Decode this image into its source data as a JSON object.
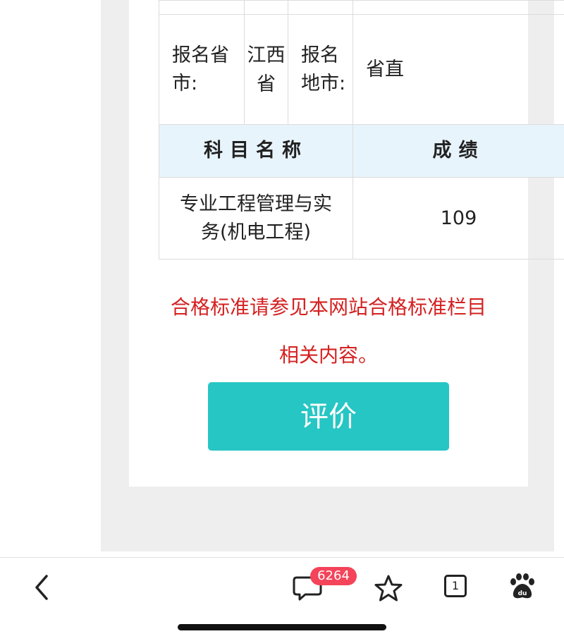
{
  "table": {
    "province_label": "报名省市:",
    "province_value": "江西省",
    "city_label": "报名地市:",
    "city_value": "省直",
    "subject_header": "科目名称",
    "score_header": "成绩",
    "subject_name": "专业工程管理与实务(机电工程)",
    "score_value": "109"
  },
  "notice": {
    "line1": "合格标准请参见本网站合格标准栏目",
    "line2": "相关内容。"
  },
  "evaluate_button": "评价",
  "bottom_nav": {
    "comment_count": "6264",
    "tab_count": "1",
    "icons": [
      "back-icon",
      "comment-icon",
      "star-icon",
      "tabs-icon",
      "baidu-icon"
    ]
  },
  "colors": {
    "notice_red": "#d42121",
    "button_teal": "#26c6c4",
    "header_bg": "#e8f4fb",
    "badge_red": "#f4445a"
  }
}
